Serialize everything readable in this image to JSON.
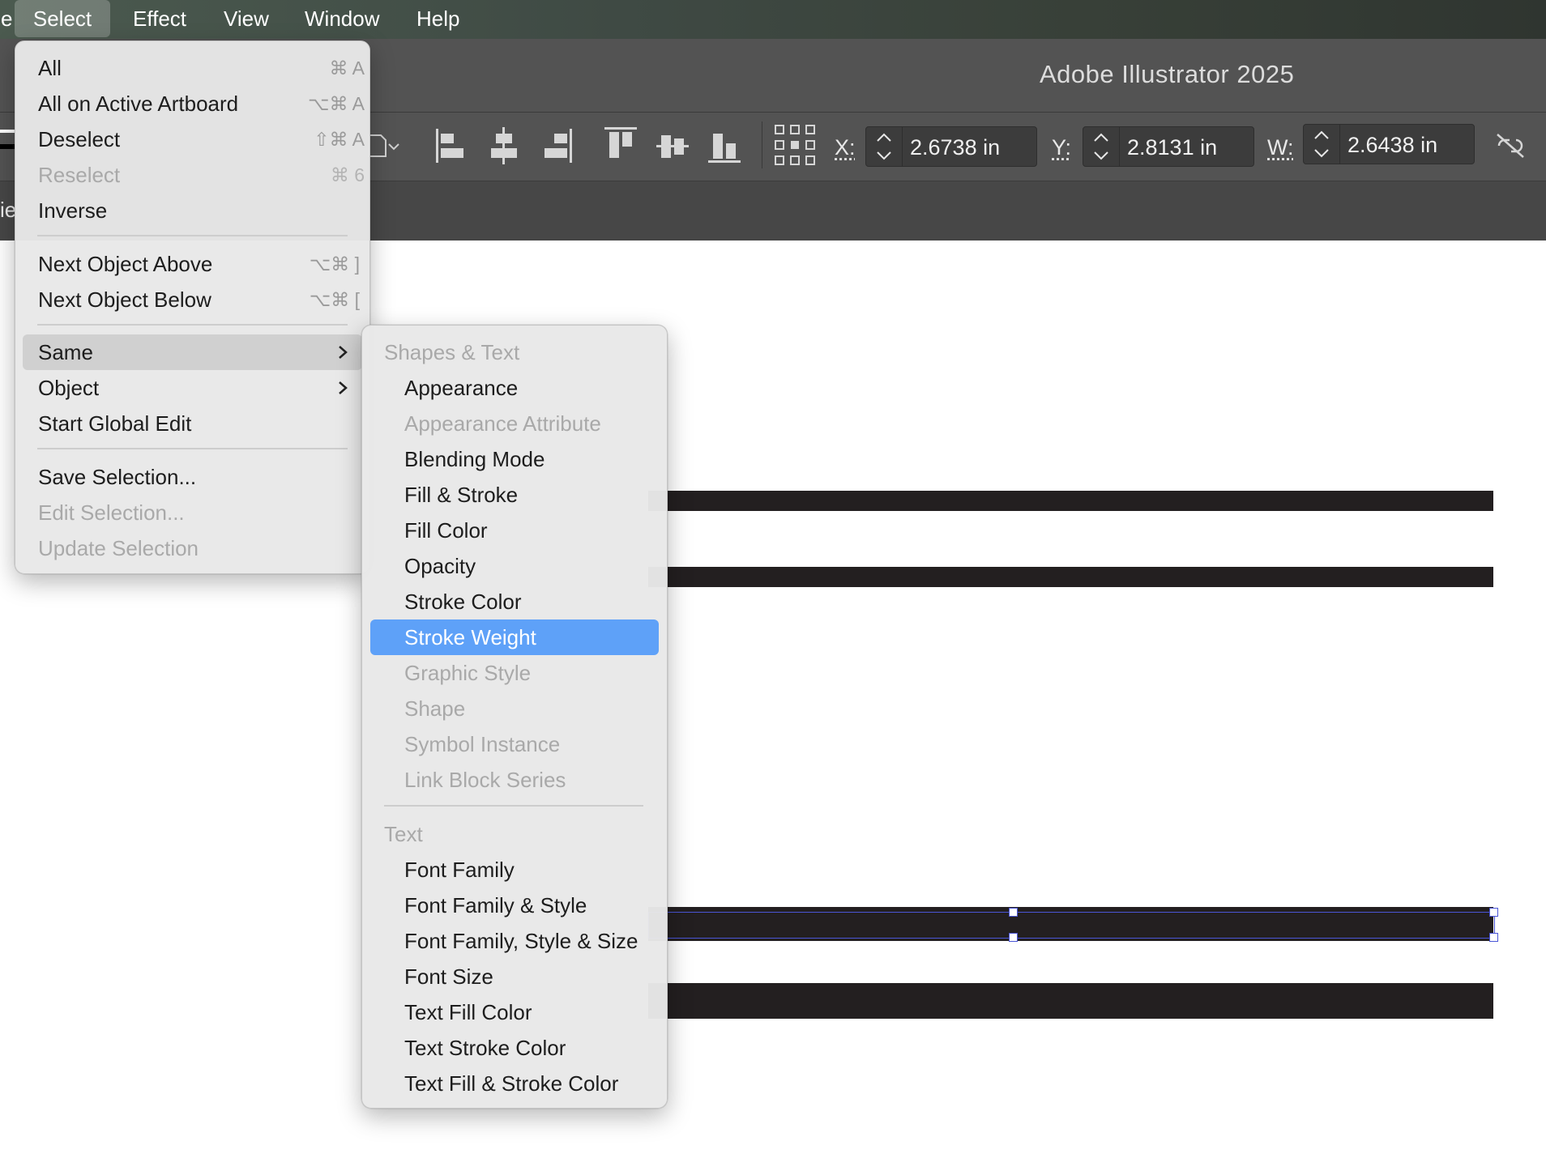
{
  "menubar": {
    "fragment": "e",
    "items": [
      "Select",
      "Effect",
      "View",
      "Window",
      "Help"
    ]
  },
  "app": {
    "title": "Adobe Illustrator 2025"
  },
  "tab_fragment": "ie",
  "transform": {
    "x_label": "X:",
    "x_value": "2.6738 in",
    "y_label": "Y:",
    "y_value": "2.8131 in",
    "w_label": "W:",
    "w_value": "2.6438 in"
  },
  "select_menu": {
    "items": [
      {
        "label": "All",
        "shortcut": "⌘ A",
        "enabled": true
      },
      {
        "label": "All on Active Artboard",
        "shortcut": "⌥⌘ A",
        "enabled": true
      },
      {
        "label": "Deselect",
        "shortcut": "⇧⌘ A",
        "enabled": true
      },
      {
        "label": "Reselect",
        "shortcut": "⌘ 6",
        "enabled": false
      },
      {
        "label": "Inverse",
        "shortcut": "",
        "enabled": true
      },
      {
        "label": "Next Object Above",
        "shortcut": "⌥⌘ ]",
        "enabled": true
      },
      {
        "label": "Next Object Below",
        "shortcut": "⌥⌘ [",
        "enabled": true
      },
      {
        "label": "Same",
        "submenu": true,
        "enabled": true,
        "highlighted": true
      },
      {
        "label": "Object",
        "submenu": true,
        "enabled": true
      },
      {
        "label": "Start Global Edit",
        "enabled": true
      },
      {
        "label": "Save Selection...",
        "enabled": true
      },
      {
        "label": "Edit Selection...",
        "enabled": false
      },
      {
        "label": "Update Selection",
        "enabled": false
      }
    ]
  },
  "same_submenu": {
    "header_shapes": "Shapes & Text",
    "items_shapes": [
      {
        "label": "Appearance",
        "enabled": true
      },
      {
        "label": "Appearance Attribute",
        "enabled": false
      },
      {
        "label": "Blending Mode",
        "enabled": true
      },
      {
        "label": "Fill & Stroke",
        "enabled": true
      },
      {
        "label": "Fill Color",
        "enabled": true
      },
      {
        "label": "Opacity",
        "enabled": true
      },
      {
        "label": "Stroke Color",
        "enabled": true
      },
      {
        "label": "Stroke Weight",
        "enabled": true,
        "highlighted": true
      },
      {
        "label": "Graphic Style",
        "enabled": false
      },
      {
        "label": "Shape",
        "enabled": false
      },
      {
        "label": "Symbol Instance",
        "enabled": false
      },
      {
        "label": "Link Block Series",
        "enabled": false
      }
    ],
    "header_text": "Text",
    "items_text": [
      {
        "label": "Font Family",
        "enabled": true
      },
      {
        "label": "Font Family & Style",
        "enabled": true
      },
      {
        "label": "Font Family, Style & Size",
        "enabled": true
      },
      {
        "label": "Font Size",
        "enabled": true
      },
      {
        "label": "Text Fill Color",
        "enabled": true
      },
      {
        "label": "Text Stroke Color",
        "enabled": true
      },
      {
        "label": "Text Fill & Stroke Color",
        "enabled": true
      }
    ]
  },
  "colors": {
    "highlight": "#5ea1f8",
    "selection": "#4a55d6",
    "stroke": "#231f20"
  }
}
